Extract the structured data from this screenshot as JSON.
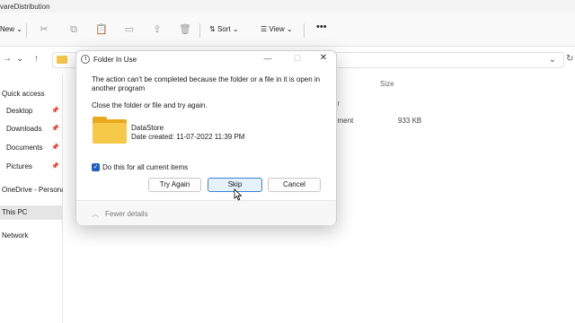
{
  "explorer": {
    "title_fragment": "vareDistribution",
    "toolbar": {
      "new_label": "New",
      "sort_label": "Sort",
      "view_label": "View",
      "more_label": "•••"
    },
    "sidebar": {
      "items": [
        {
          "label": "Quick access"
        },
        {
          "label": "Desktop"
        },
        {
          "label": "Downloads"
        },
        {
          "label": "Documents"
        },
        {
          "label": "Pictures"
        },
        {
          "label": "OneDrive - Personal"
        },
        {
          "label": "This PC"
        },
        {
          "label": "Network"
        }
      ]
    },
    "list": {
      "column_size": "Size",
      "column_fragment": "er",
      "row": {
        "type_fragment": "ument",
        "size": "933 KB"
      }
    }
  },
  "dialog": {
    "title": "Folder In Use",
    "message": "The action can't be completed because the folder or a file in it is open in another program",
    "sub_message": "Close the folder or file and try again.",
    "file": {
      "name": "DataStore",
      "date_created": "Date created: 11-07-2022 11:39 PM"
    },
    "checkbox": {
      "label": "Do this for all current items",
      "checked": true
    },
    "buttons": {
      "try_again": "Try Again",
      "skip": "Skip",
      "cancel": "Cancel"
    },
    "footer": {
      "fewer_details": "Fewer details"
    }
  }
}
